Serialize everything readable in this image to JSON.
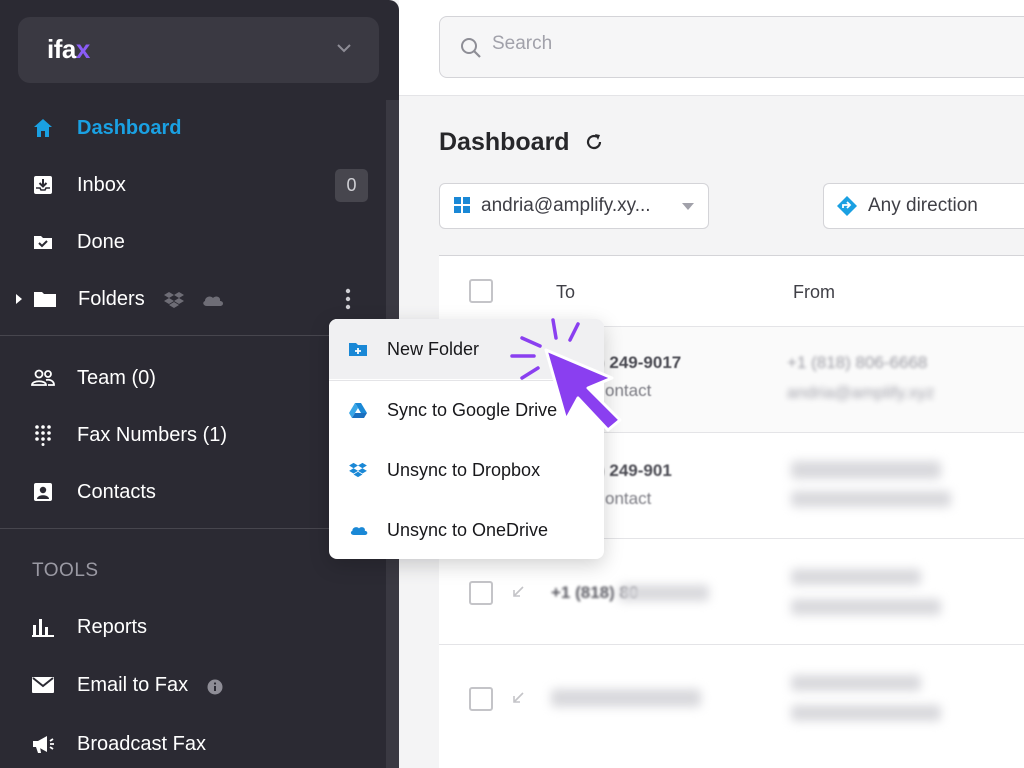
{
  "brand": {
    "logo_main": "ifa",
    "logo_accent": "x"
  },
  "search": {
    "placeholder": "Search"
  },
  "nav": {
    "dashboard": "Dashboard",
    "inbox": "Inbox",
    "inbox_count": "0",
    "done": "Done",
    "folders": "Folders",
    "team": "Team (0)",
    "fax_numbers": "Fax Numbers (1)",
    "contacts": "Contacts",
    "tools_title": "TOOLS",
    "reports": "Reports",
    "email_to_fax": "Email to Fax",
    "broadcast_fax": "Broadcast Fax"
  },
  "main": {
    "title": "Dashboard",
    "account_filter": "andria@amplify.xy...",
    "direction_filter": "Any direction",
    "columns": {
      "to": "To",
      "from": "From"
    }
  },
  "rows": [
    {
      "to": ") 249-9017",
      "to_sub": "ontact",
      "from": "+1 (818) 806-6668",
      "from_sub": "andria@amplify.xyz"
    },
    {
      "to": ") 249-901",
      "to_sub": "ontact",
      "from": "",
      "from_sub": ""
    },
    {
      "to": "+1 (818) 80",
      "to_sub": "",
      "from": "",
      "from_sub": ""
    },
    {
      "to": "",
      "to_sub": "",
      "from": "",
      "from_sub": ""
    }
  ],
  "menu": {
    "new_folder": "New Folder",
    "sync_google": "Sync to Google Drive",
    "unsync_dropbox": "Unsync to Dropbox",
    "unsync_onedrive": "Unsync to OneDrive"
  },
  "colors": {
    "accent": "#1aa0e2",
    "sidebar": "#2b2a33",
    "cursor": "#8a3ff0"
  }
}
